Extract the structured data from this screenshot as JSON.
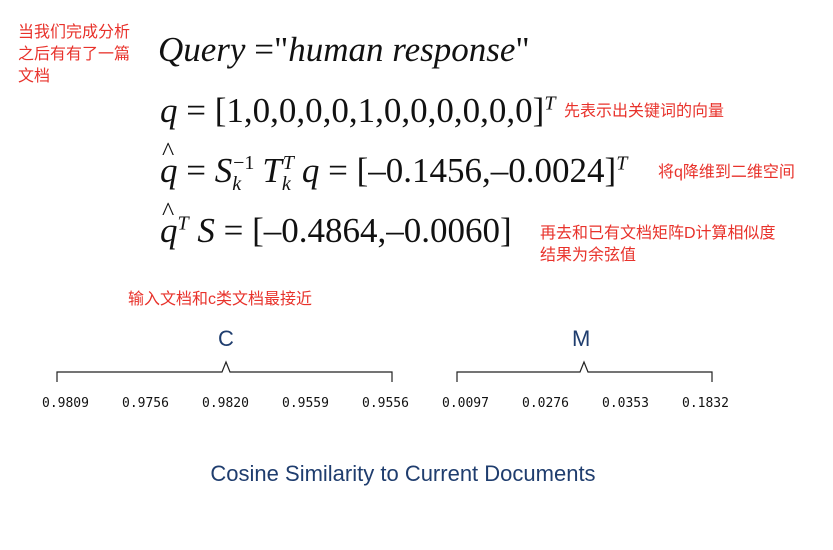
{
  "annotations": {
    "intro": "当我们完成分析\n之后有有了一篇\n文档",
    "query_vector": "先表示出关键词的向量",
    "reduce": "将q降维到二维空间",
    "similarity": "再去和已有文档矩阵D计算相似度\n结果为余弦值",
    "closest": "输入文档和c类文档最接近"
  },
  "equations": {
    "query": {
      "lhs": "Query",
      "eq": " =\"",
      "text": "human response",
      "end": "\""
    },
    "q_vector": "[1,0,0,0,0,1,0,0,0,0,0,0]",
    "q_hat": "[–0.1456,–0.0024]",
    "qT_S": "[–0.4864,–0.0060]"
  },
  "groups": {
    "c_label": "C",
    "m_label": "M"
  },
  "values": [
    "0.9809",
    "0.9756",
    "0.9820",
    "0.9559",
    "0.9556",
    "0.0097",
    "0.0276",
    "0.0353",
    "0.1832"
  ],
  "caption": "Cosine Similarity to Current Documents",
  "colors": {
    "annotation": "#e8322b",
    "heading": "#1f3d6e"
  }
}
